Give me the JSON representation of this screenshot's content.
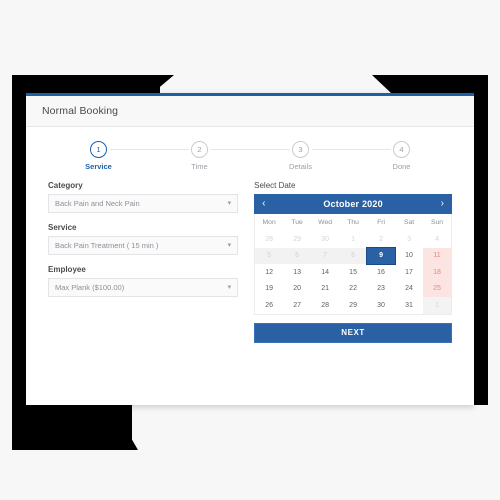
{
  "card": {
    "title": "Normal Booking"
  },
  "stepper": {
    "steps": [
      {
        "number": "1",
        "label": "Service",
        "active": true
      },
      {
        "number": "2",
        "label": "Time",
        "active": false
      },
      {
        "number": "3",
        "label": "Details",
        "active": false
      },
      {
        "number": "4",
        "label": "Done",
        "active": false
      }
    ]
  },
  "form": {
    "category": {
      "label": "Category",
      "value": "Back Pain and Neck Pain",
      "icon": "chevron-down-icon"
    },
    "service": {
      "label": "Service",
      "value": "Back Pain Treatment ( 15 min )",
      "icon": "chevron-down-icon"
    },
    "employee": {
      "label": "Employee",
      "value": "Max Plank ($100.00)",
      "icon": "chevron-down-icon"
    }
  },
  "calendar": {
    "label": "Select Date",
    "month_title": "October 2020",
    "prev_icon": "chevron-left-icon",
    "prev_glyph": "‹",
    "next_icon": "chevron-right-icon",
    "next_glyph": "›",
    "weekdays": [
      "Mon",
      "Tue",
      "Wed",
      "Thu",
      "Fri",
      "Sat",
      "Sun"
    ],
    "selected_day": "9",
    "weeks": [
      [
        {
          "day": "28",
          "state": "muted"
        },
        {
          "day": "29",
          "state": "muted"
        },
        {
          "day": "30",
          "state": "muted"
        },
        {
          "day": "1",
          "state": "muted"
        },
        {
          "day": "2",
          "state": "muted"
        },
        {
          "day": "3",
          "state": "muted"
        },
        {
          "day": "4",
          "state": "muted"
        }
      ],
      [
        {
          "day": "5",
          "state": "rowgrey"
        },
        {
          "day": "6",
          "state": "rowgrey"
        },
        {
          "day": "7",
          "state": "rowgrey"
        },
        {
          "day": "8",
          "state": "rowgrey"
        },
        {
          "day": "9",
          "state": "selected"
        },
        {
          "day": "10",
          "state": "normal"
        },
        {
          "day": "11",
          "state": "weekend"
        }
      ],
      [
        {
          "day": "12",
          "state": "normal"
        },
        {
          "day": "13",
          "state": "normal"
        },
        {
          "day": "14",
          "state": "normal"
        },
        {
          "day": "15",
          "state": "normal"
        },
        {
          "day": "16",
          "state": "normal"
        },
        {
          "day": "17",
          "state": "normal"
        },
        {
          "day": "18",
          "state": "weekend"
        }
      ],
      [
        {
          "day": "19",
          "state": "normal"
        },
        {
          "day": "20",
          "state": "normal"
        },
        {
          "day": "21",
          "state": "normal"
        },
        {
          "day": "22",
          "state": "normal"
        },
        {
          "day": "23",
          "state": "normal"
        },
        {
          "day": "24",
          "state": "normal"
        },
        {
          "day": "25",
          "state": "weekend"
        }
      ],
      [
        {
          "day": "26",
          "state": "normal"
        },
        {
          "day": "27",
          "state": "normal"
        },
        {
          "day": "28",
          "state": "normal"
        },
        {
          "day": "29",
          "state": "normal"
        },
        {
          "day": "30",
          "state": "normal"
        },
        {
          "day": "31",
          "state": "normal"
        },
        {
          "day": "1",
          "state": "weekend-muted"
        }
      ]
    ]
  },
  "actions": {
    "next_label": "NEXT"
  },
  "colors": {
    "accent_blue": "#2961a4",
    "card_top_rule": "#1f5fa8",
    "weekend_bg": "#fbe4e2",
    "weekend_text": "#e9897d",
    "muted_text": "#d2d5d9"
  }
}
